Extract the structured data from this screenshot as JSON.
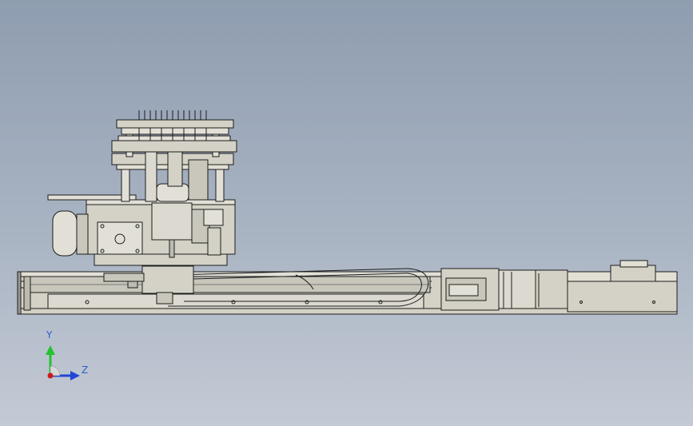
{
  "triad": {
    "y_label": "Y",
    "z_label": "Z",
    "colors": {
      "y": "#22c232",
      "z": "#1f46d6",
      "origin": "#d01818"
    }
  },
  "model": {
    "colors": {
      "body": "#d4d2c6",
      "body_light": "#e2e0d6",
      "body_dark": "#b9b7ab",
      "line": "#1c1c1c",
      "rail": "#9a9a94"
    }
  }
}
